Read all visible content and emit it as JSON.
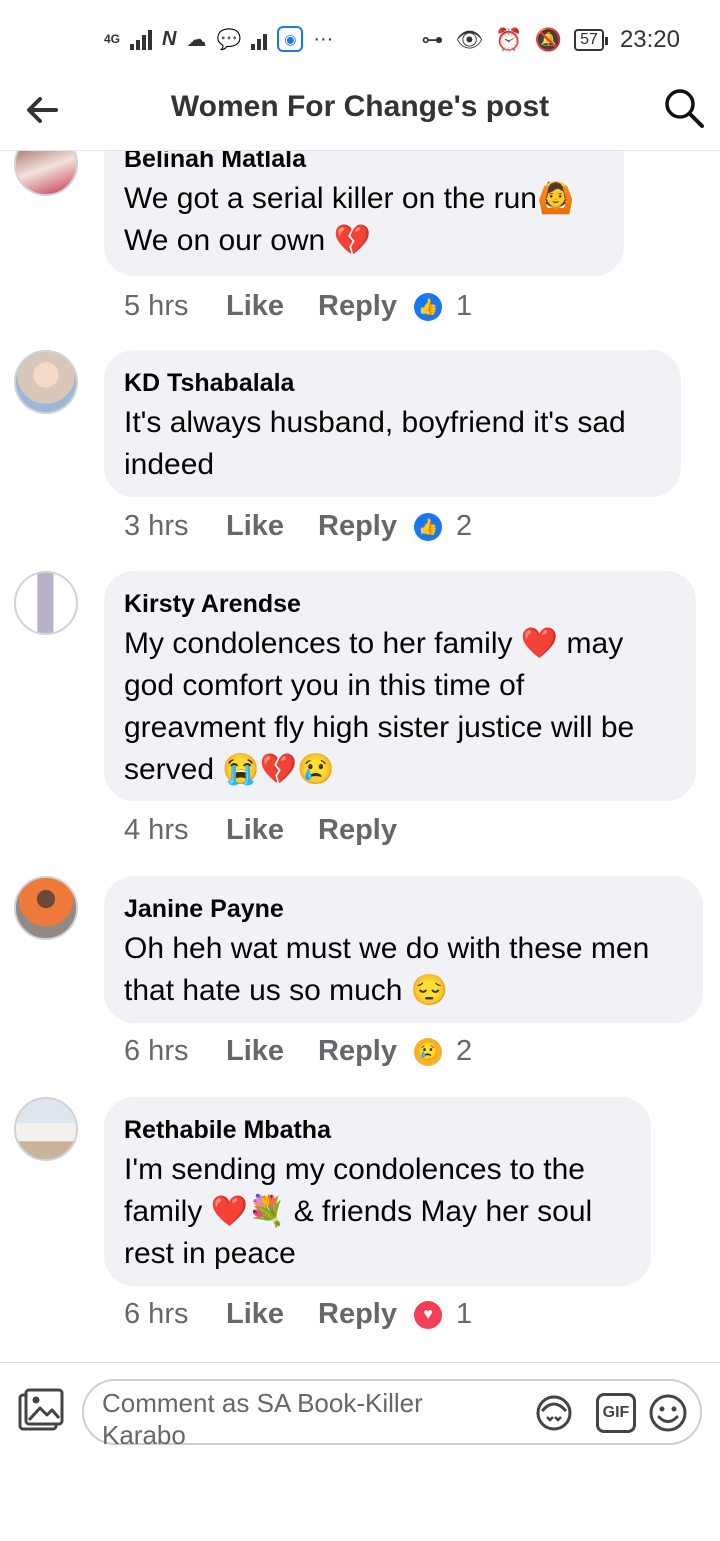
{
  "status_bar": {
    "time": "23:20",
    "battery": "57",
    "network_4g": "4G",
    "more": "···"
  },
  "header": {
    "title": "Women For Change's post"
  },
  "comments": [
    {
      "name": "Belinah Matlala",
      "lines": [
        "We got a serial killer on the run🙆",
        "We on our own 💔"
      ],
      "time": "5 hrs",
      "like": "Like",
      "reply": "Reply",
      "reaction": "like",
      "count": "1"
    },
    {
      "name": "KD  Tshabalala",
      "lines": [
        "It's always husband, boyfriend it's sad",
        "indeed"
      ],
      "time": "3 hrs",
      "like": "Like",
      "reply": "Reply",
      "reaction": "like",
      "count": "2"
    },
    {
      "name": "Kirsty Arendse",
      "lines": [
        "My condolences to her family ❤️ may",
        "god comfort you in this time of",
        "greavment fly high sister justice will be",
        "served 😭💔😢"
      ],
      "time": "4 hrs",
      "like": "Like",
      "reply": "Reply",
      "reaction": "",
      "count": ""
    },
    {
      "name": "Janine Payne",
      "lines": [
        "Oh heh wat must we do with these men",
        "that hate us so much 😔"
      ],
      "time": "6 hrs",
      "like": "Like",
      "reply": "Reply",
      "reaction": "sad",
      "count": "2"
    },
    {
      "name": "Rethabile Mbatha",
      "lines": [
        "I'm sending my condolences to the",
        "family ❤️💐 & friends May her soul",
        "rest in peace"
      ],
      "time": "6 hrs",
      "like": "Like",
      "reply": "Reply",
      "reaction": "love",
      "count": "1"
    }
  ],
  "composer": {
    "placeholder": "Comment as SA Book-Killer Karabo",
    "gif_label": "GIF"
  },
  "colors": {
    "accent": "#1877f2",
    "bubble": "#f0f2f5",
    "muted": "#65676b",
    "love": "#f33e58",
    "sad": "#f7b125"
  }
}
